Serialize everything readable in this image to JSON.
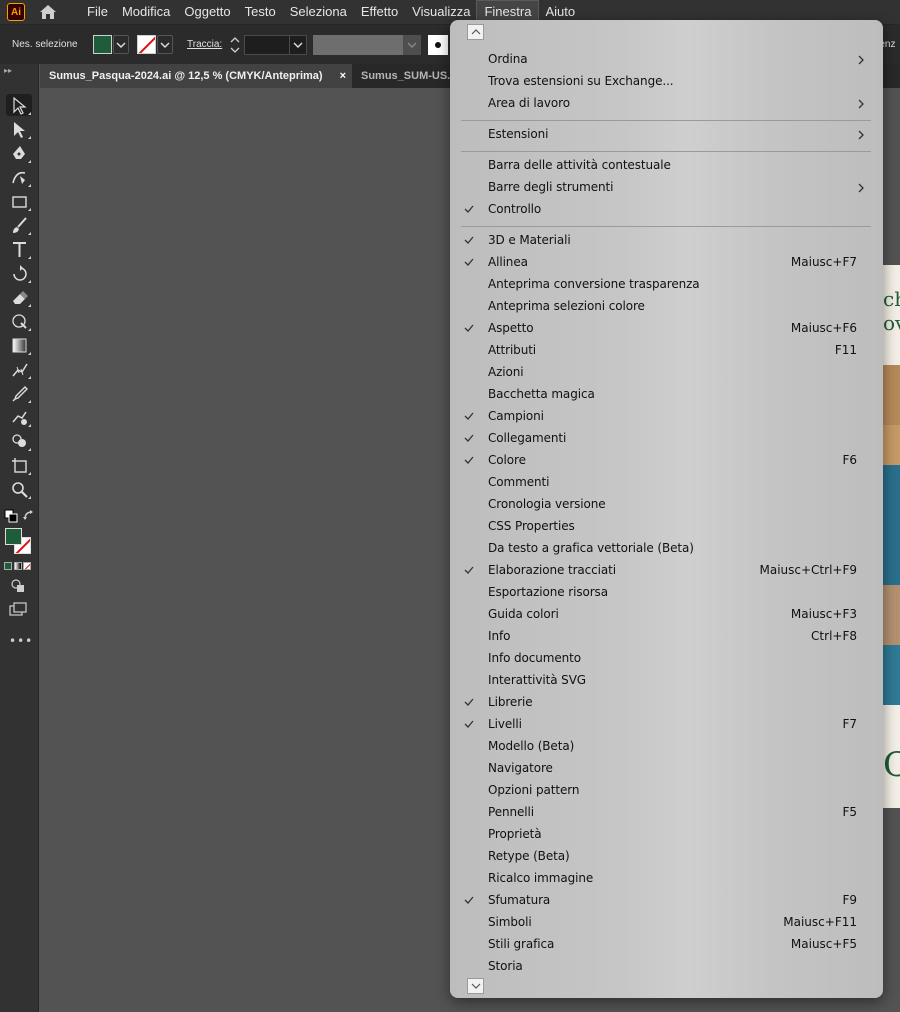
{
  "app": {
    "logo": "Ai",
    "menu": [
      "File",
      "Modifica",
      "Oggetto",
      "Testo",
      "Seleziona",
      "Effetto",
      "Visualizza",
      "Finestra",
      "Aiuto"
    ],
    "active_menu_index": 7
  },
  "control_bar": {
    "selection_label": "Nes. selezione",
    "stroke_label": "Traccia:",
    "transparency_label": "renz",
    "fill_color": "#1f5c3a"
  },
  "tabs": [
    {
      "title": "Sumus_Pasqua-2024.ai @ 12,5 % (CMYK/Anteprima)",
      "close": "×",
      "active": true
    },
    {
      "title": "Sumus_SUM-US.a",
      "active": false
    }
  ],
  "toolbar": {
    "tools": [
      "selection-tool",
      "direct-selection-tool",
      "pen-tool",
      "curvature-tool",
      "rectangle-tool",
      "paintbrush-tool",
      "type-tool",
      "rotate-tool",
      "eraser-tool",
      "puppet-warp-tool",
      "gradient-tool",
      "width-tool",
      "eyedropper-tool",
      "blend-tool",
      "shape-builder-tool",
      "artboard-tool",
      "zoom-tool"
    ],
    "more": "•••"
  },
  "artboard": {
    "text_1": "ch",
    "text_2": "ov",
    "text_3": "C"
  },
  "finestra_menu": {
    "groups": [
      [
        {
          "label": "Ordina",
          "submenu": true
        },
        {
          "label": "Trova estensioni su Exchange..."
        },
        {
          "label": "Area di lavoro",
          "submenu": true
        }
      ],
      [
        {
          "label": "Estensioni",
          "submenu": true
        }
      ],
      [
        {
          "label": "Barra delle attività contestuale"
        },
        {
          "label": "Barre degli strumenti",
          "submenu": true
        },
        {
          "label": "Controllo",
          "checked": true
        }
      ],
      [
        {
          "label": "3D e Materiali",
          "checked": true
        },
        {
          "label": "Allinea",
          "checked": true,
          "shortcut": "Maiusc+F7"
        },
        {
          "label": "Anteprima conversione trasparenza"
        },
        {
          "label": "Anteprima selezioni colore"
        },
        {
          "label": "Aspetto",
          "checked": true,
          "shortcut": "Maiusc+F6"
        },
        {
          "label": "Attributi",
          "shortcut": "F11"
        },
        {
          "label": "Azioni"
        },
        {
          "label": "Bacchetta magica"
        },
        {
          "label": "Campioni",
          "checked": true
        },
        {
          "label": "Collegamenti",
          "checked": true
        },
        {
          "label": "Colore",
          "checked": true,
          "shortcut": "F6"
        },
        {
          "label": "Commenti"
        },
        {
          "label": "Cronologia versione"
        },
        {
          "label": "CSS Properties"
        },
        {
          "label": "Da testo a grafica vettoriale (Beta)"
        },
        {
          "label": "Elaborazione tracciati",
          "checked": true,
          "shortcut": "Maiusc+Ctrl+F9"
        },
        {
          "label": "Esportazione risorsa"
        },
        {
          "label": "Guida colori",
          "shortcut": "Maiusc+F3"
        },
        {
          "label": "Info",
          "shortcut": "Ctrl+F8"
        },
        {
          "label": "Info documento"
        },
        {
          "label": "Interattività SVG"
        },
        {
          "label": "Librerie",
          "checked": true
        },
        {
          "label": "Livelli",
          "checked": true,
          "shortcut": "F7"
        },
        {
          "label": "Modello (Beta)"
        },
        {
          "label": "Navigatore"
        },
        {
          "label": "Opzioni pattern"
        },
        {
          "label": "Pennelli",
          "shortcut": "F5"
        },
        {
          "label": "Proprietà"
        },
        {
          "label": "Retype (Beta)"
        },
        {
          "label": "Ricalco immagine"
        },
        {
          "label": "Sfumatura",
          "checked": true,
          "shortcut": "F9"
        },
        {
          "label": "Simboli",
          "shortcut": "Maiusc+F11"
        },
        {
          "label": "Stili grafica",
          "shortcut": "Maiusc+F5"
        },
        {
          "label": "Storia"
        }
      ]
    ]
  }
}
